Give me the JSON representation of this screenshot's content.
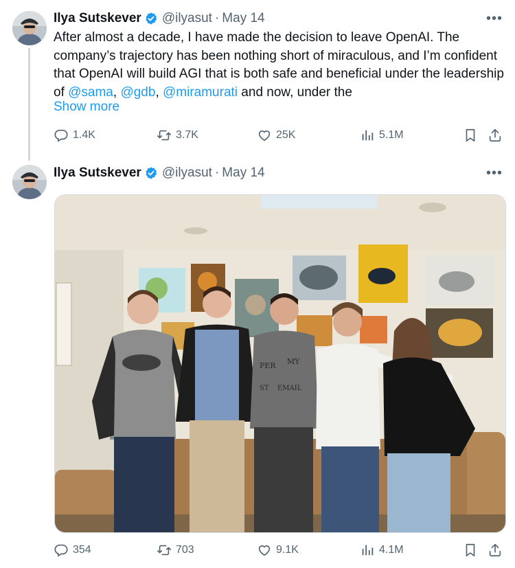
{
  "tweet1": {
    "author": {
      "name": "Ilya Sutskever",
      "handle": "@ilyasut",
      "date": "May 14"
    },
    "text_before": "After almost a decade, I have made the decision to leave OpenAI.  The company’s trajectory has been nothing short of miraculous, and I’m confident that OpenAI will build AGI that is both safe and beneficial under the leadership of ",
    "mention1": "@sama",
    "sep1": ", ",
    "mention2": "@gdb",
    "sep2": ", ",
    "mention3": "@miramurati",
    "text_after": " and now, under the",
    "show_more": "Show more",
    "stats": {
      "replies": "1.4K",
      "reposts": "3.7K",
      "likes": "25K",
      "views": "5.1M"
    }
  },
  "tweet2": {
    "author": {
      "name": "Ilya Sutskever",
      "handle": "@ilyasut",
      "date": "May 14"
    },
    "shirt_text": [
      "PER",
      "MY",
      "ST",
      "EMAIL"
    ],
    "stats": {
      "replies": "354",
      "reposts": "703",
      "likes": "9.1K",
      "views": "4.1M"
    }
  },
  "more_glyph": "•••",
  "dot": "·",
  "colors": {
    "link": "#1d9bf0",
    "verified": "#1d9bf0",
    "muted": "#536471"
  }
}
